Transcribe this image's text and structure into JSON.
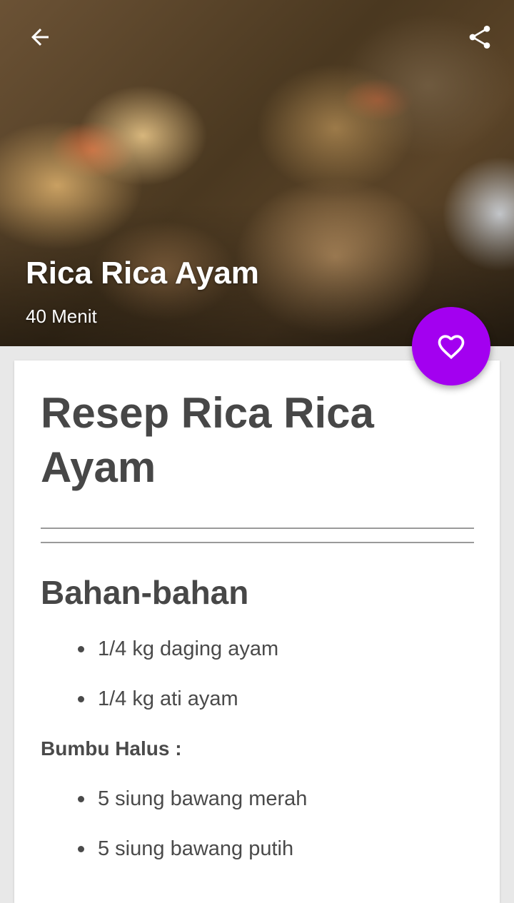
{
  "hero": {
    "title": "Rica Rica Ayam",
    "duration": "40 Menit"
  },
  "icons": {
    "back": "arrow-left-icon",
    "share": "share-icon",
    "favorite": "heart-outline-icon"
  },
  "colors": {
    "accent": "#a300f0",
    "text": "#4a4a4a",
    "background": "#e8e8e8"
  },
  "recipe": {
    "title": "Resep Rica Rica Ayam",
    "ingredients_heading": "Bahan-bahan",
    "ingredients": [
      "1/4 kg daging ayam",
      "1/4 kg ati ayam"
    ],
    "bumbu_heading": "Bumbu Halus :",
    "bumbu": [
      "5 siung bawang merah",
      "5 siung bawang putih"
    ]
  }
}
